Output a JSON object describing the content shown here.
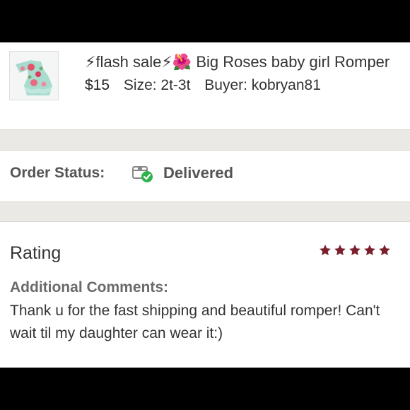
{
  "item": {
    "title": "⚡flash sale⚡🌺 Big Roses baby girl Romper",
    "price": "$15",
    "size": "Size: 2t-3t",
    "buyer": "Buyer: kobryan81"
  },
  "order": {
    "status_label": "Order Status:",
    "status_value": "Delivered",
    "status_icon": "package-delivered-icon",
    "status_icon_color": "#2fb24c"
  },
  "rating": {
    "title": "Rating",
    "stars": 5,
    "star_color": "#7b1f2c",
    "comments_label": "Additional Comments:",
    "comments_text": "Thank u for the fast shipping and beautiful romper! Can't wait til my daughter can wear it:)"
  }
}
